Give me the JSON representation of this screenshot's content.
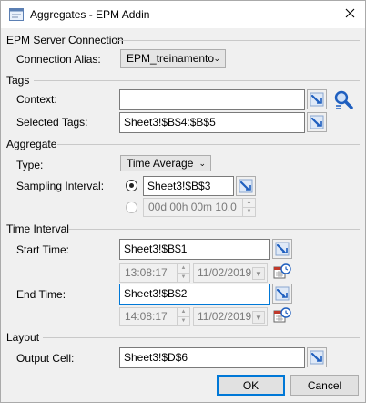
{
  "window": {
    "title": "Aggregates - EPM Addin"
  },
  "server": {
    "section": "EPM Server Connection",
    "alias_label": "Connection Alias:",
    "alias_value": "EPM_treinamento"
  },
  "tags": {
    "section": "Tags",
    "context_label": "Context:",
    "context_value": "",
    "selected_label": "Selected Tags:",
    "selected_value": "Sheet3!$B$4:$B$5"
  },
  "aggregate": {
    "section": "Aggregate",
    "type_label": "Type:",
    "type_value": "Time Average",
    "sampling_label": "Sampling Interval:",
    "sampling_cell": "Sheet3!$B$3",
    "sampling_duration": "00d 00h 00m 10.0",
    "cell_option_selected": true
  },
  "time": {
    "section": "Time Interval",
    "start_label": "Start Time:",
    "start_value": "Sheet3!$B$1",
    "start_time": "13:08:17",
    "start_date": "11/02/2019",
    "end_label": "End Time:",
    "end_value": "Sheet3!$B$2",
    "end_time": "14:08:17",
    "end_date": "11/02/2019"
  },
  "layout": {
    "section": "Layout",
    "output_label": "Output Cell:",
    "output_value": "Sheet3!$D$6"
  },
  "buttons": {
    "ok": "OK",
    "cancel": "Cancel"
  },
  "icons": {
    "title": "window-icon",
    "close": "close-icon",
    "cell_picker": "cell-picker-icon",
    "tag_browser": "tag-browser-icon",
    "calendar": "calendar-clock-icon"
  },
  "colors": {
    "focus": "#0078d7",
    "picker_blue": "#1f5fbf"
  }
}
